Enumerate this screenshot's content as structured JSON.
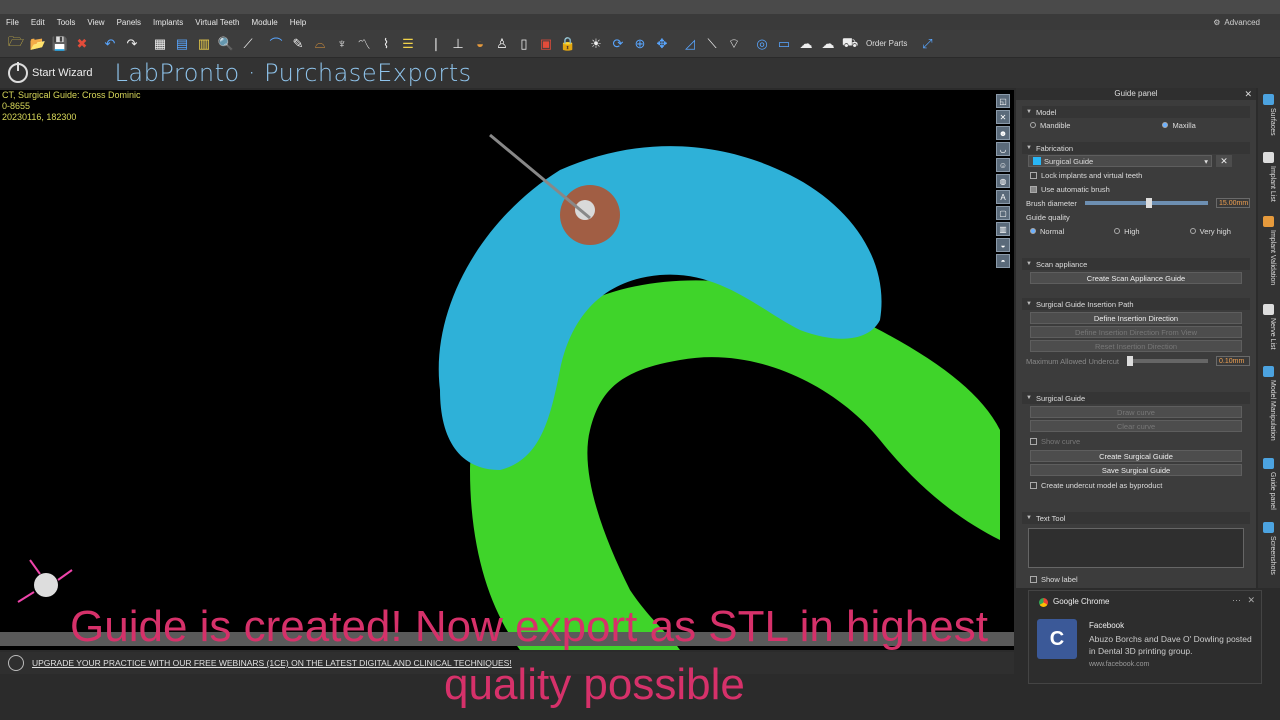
{
  "menu": {
    "items": [
      "File",
      "Edit",
      "Tools",
      "View",
      "Panels",
      "Implants",
      "Virtual Teeth",
      "Module",
      "Help"
    ],
    "mode": "Advanced"
  },
  "toolbar": {
    "order_parts_label": "Order Parts"
  },
  "wizard": {
    "start_label": "Start Wizard",
    "brand_text": "LabPronto · PurchaseExports"
  },
  "case_info": {
    "line1": "CT, Surgical Guide: Cross Dominic",
    "line2": "0-8655",
    "line3": "20230116, 182300"
  },
  "banner": {
    "text": "UPGRADE YOUR PRACTICE WITH OUR FREE WEBINARS (1CE) ON THE LATEST DIGITAL AND CLINICAL TECHNIQUES!"
  },
  "panel": {
    "title": "Guide panel",
    "model": {
      "header": "Model",
      "mandible": "Mandible",
      "maxilla": "Maxilla",
      "selected": "Maxilla"
    },
    "fabrication": {
      "header": "Fabrication",
      "type": "Surgical Guide",
      "lock_label": "Lock implants and virtual teeth",
      "auto_brush_label": "Use automatic brush",
      "brush_diameter_label": "Brush diameter",
      "brush_diameter_value": "15.00mm",
      "brush_diameter_fraction": 0.5,
      "quality_label": "Guide quality",
      "quality_normal": "Normal",
      "quality_high": "High",
      "quality_very_high": "Very high",
      "quality_selected": "Normal"
    },
    "scan_appliance": {
      "header": "Scan appliance",
      "button": "Create Scan Appliance Guide"
    },
    "insertion": {
      "header": "Surgical Guide Insertion Path",
      "define": "Define Insertion Direction",
      "define_from_view": "Define Insertion Direction From View",
      "reset": "Reset Insertion Direction",
      "undercut_label": "Maximum Allowed Undercut",
      "undercut_value": "0.10mm",
      "undercut_fraction": 0.0
    },
    "surgical_guide": {
      "header": "Surgical Guide",
      "draw_curve": "Draw curve",
      "clear_curve": "Clear curve",
      "show_curve": "Show curve",
      "create": "Create Surgical Guide",
      "save": "Save Surgical Guide",
      "undercut_model": "Create undercut model as byproduct"
    },
    "text_tool": {
      "header": "Text Tool",
      "show_label": "Show label"
    }
  },
  "side_tabs": [
    "Surfaces",
    "Implant List",
    "Implant Validation",
    "Nerve List",
    "Model Manipulation",
    "Guide panel",
    "Screenshots"
  ],
  "notification": {
    "app": "Google Chrome",
    "title": "Facebook",
    "body": "Abuzo Borchs and Dave O' Dowling posted in Dental 3D printing group.",
    "source": "www.facebook.com"
  },
  "caption": {
    "line1": "Guide is created! Now export as STL in highest",
    "line2": "quality possible"
  }
}
